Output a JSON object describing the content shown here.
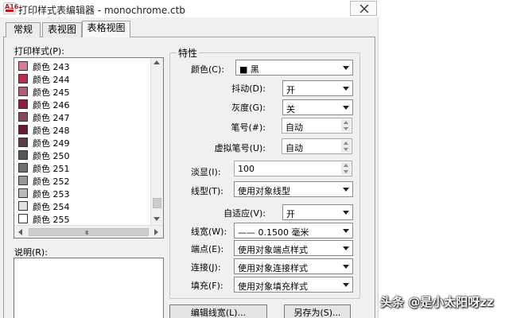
{
  "window": {
    "title": "打印样式表编辑器 - monochrome.ctb"
  },
  "tabs": [
    {
      "label": "常规",
      "active": false
    },
    {
      "label": "表视图",
      "active": false
    },
    {
      "label": "表格视图",
      "active": true
    }
  ],
  "styles_panel": {
    "label": "打印样式(P):",
    "items": [
      {
        "name": "颜色 243",
        "color": "#d87c96"
      },
      {
        "name": "颜色 244",
        "color": "#c0284e"
      },
      {
        "name": "颜色 245",
        "color": "#b45a72"
      },
      {
        "name": "颜色 246",
        "color": "#941a3e"
      },
      {
        "name": "颜色 247",
        "color": "#864560"
      },
      {
        "name": "颜色 248",
        "color": "#6a1832"
      },
      {
        "name": "颜色 249",
        "color": "#5e3a48"
      },
      {
        "name": "颜色 250",
        "color": "#555555"
      },
      {
        "name": "颜色 251",
        "color": "#707070"
      },
      {
        "name": "颜色 252",
        "color": "#979797"
      },
      {
        "name": "颜色 253",
        "color": "#b9b9b9"
      },
      {
        "name": "颜色 254",
        "color": "#e2e2e2"
      },
      {
        "name": "颜色 255",
        "color": "#ffffff"
      }
    ],
    "description_label": "说明(R):"
  },
  "properties": {
    "group_title": "特性",
    "color_label": "颜色(C):",
    "color_value": "■ 黑",
    "dither_label": "抖动(D):",
    "dither_value": "开",
    "grayscale_label": "灰度(G):",
    "grayscale_value": "关",
    "pen_label": "笔号(#):",
    "pen_value": "自动",
    "virtual_pen_label": "虚拟笔号(U):",
    "virtual_pen_value": "自动",
    "screening_label": "淡显(I):",
    "screening_value": "100",
    "linetype_label": "线型(T):",
    "linetype_value": "使用对象线型",
    "adaptive_label": "自适应(V):",
    "adaptive_value": "开",
    "lineweight_label": "线宽(W):",
    "lineweight_value": "—— 0.1500 毫米",
    "endstyle_label": "端点(E):",
    "endstyle_value": "使用对象端点样式",
    "joinstyle_label": "连接(J):",
    "joinstyle_value": "使用对象连接样式",
    "fillstyle_label": "填充(F):",
    "fillstyle_value": "使用对象填充样式"
  },
  "buttons": {
    "edit_lineweights": "编辑线宽(L)...",
    "save_as": "另存为(S)..."
  },
  "watermark": "头条 @是小太阳呀zz"
}
